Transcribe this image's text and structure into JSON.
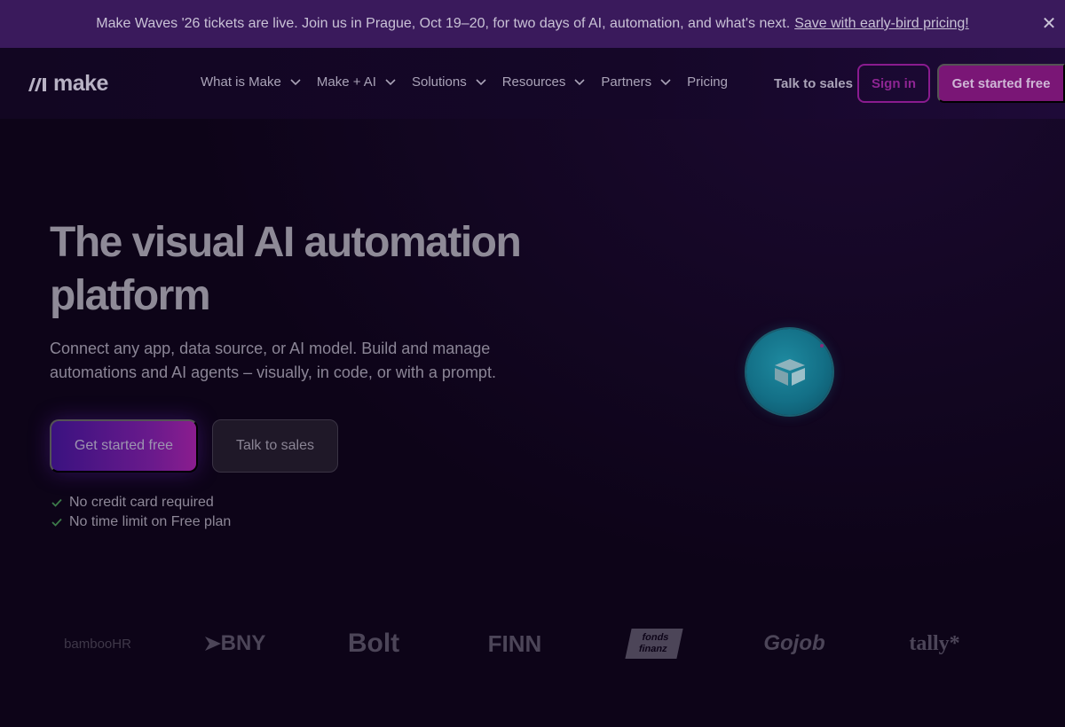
{
  "announcement": {
    "text": "Make Waves '26 tickets are live. Join us in Prague, Oct 19–20, for two days of AI, automation, and what's next.",
    "link": "Save with early-bird pricing!",
    "close_icon": "close-icon"
  },
  "nav": {
    "logo_text": "make",
    "items": [
      {
        "label": "What is Make",
        "has_dropdown": true
      },
      {
        "label": "Make + AI",
        "has_dropdown": true
      },
      {
        "label": "Solutions",
        "has_dropdown": true
      },
      {
        "label": "Resources",
        "has_dropdown": true
      },
      {
        "label": "Partners",
        "has_dropdown": true
      },
      {
        "label": "Pricing",
        "has_dropdown": false
      }
    ],
    "talk_to_sales": "Talk to sales",
    "sign_in": "Sign in",
    "get_started": "Get started free"
  },
  "hero": {
    "title_line1": "The visual AI automation",
    "title_line2": "platform",
    "subtitle_line1": "Connect any app, data source, or AI model. Build and manage",
    "subtitle_line2": "automations and AI agents – visually, in code, or with a prompt.",
    "primary_cta": "Get started free",
    "secondary_cta": "Talk to sales",
    "checks": [
      "No credit card required",
      "No time limit on Free plan"
    ]
  },
  "logos": [
    "bambooHR",
    "BNY",
    "Bolt",
    "FINN",
    "fonds finanz",
    "Gojob",
    "tally*"
  ],
  "colors": {
    "background": "#0d0418",
    "announcement_bg": "#3a1a5c",
    "accent_magenta": "#7a1676",
    "orb_teal": "#136f86"
  }
}
